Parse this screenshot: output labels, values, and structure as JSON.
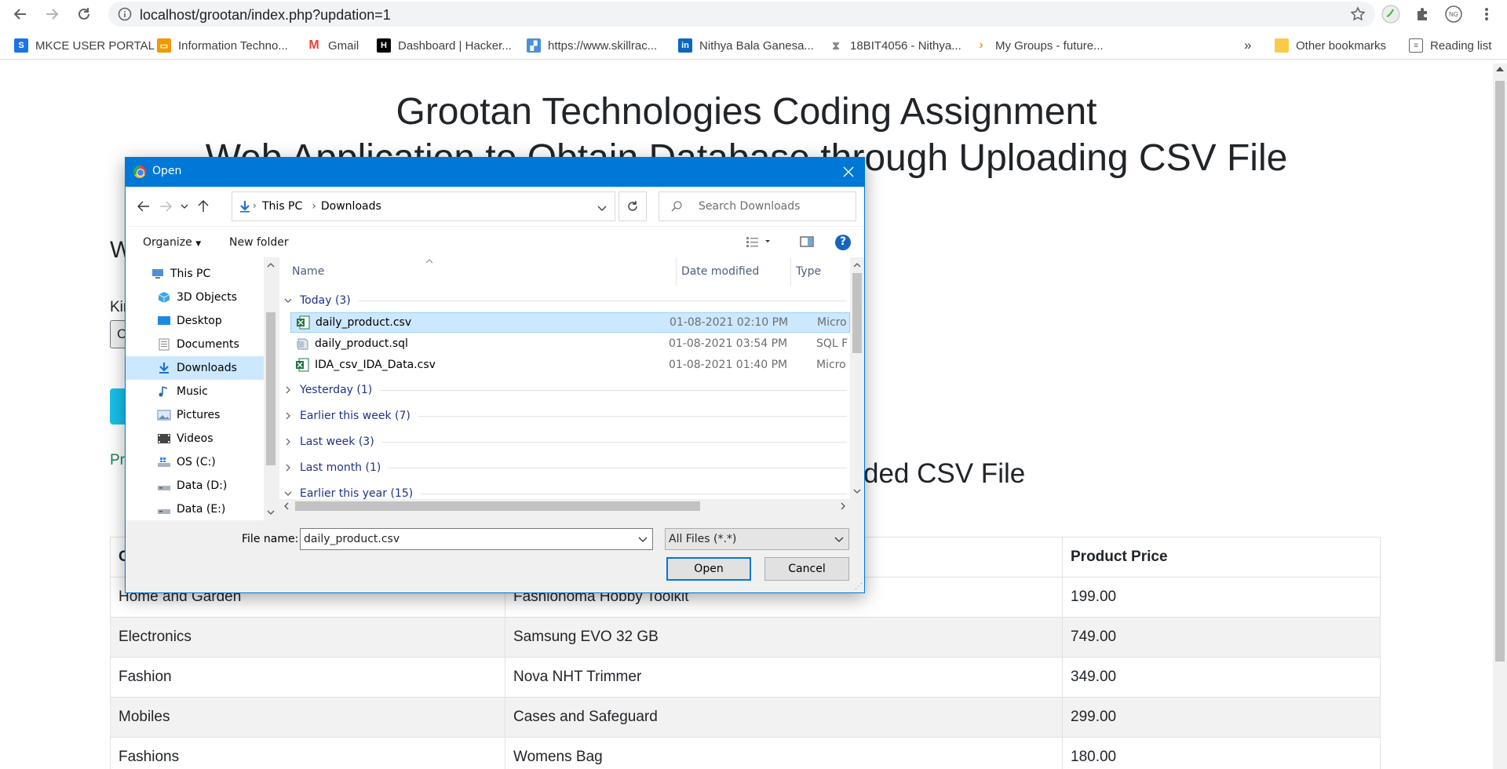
{
  "browser": {
    "url": "localhost/grootan/index.php?updation=1",
    "profile_initials": "NG",
    "bookmarks": [
      {
        "label": "MKCE USER PORTAL",
        "icon": "portal-icon",
        "color": "#1a73e8"
      },
      {
        "label": "Information Techno...",
        "icon": "monitor-icon",
        "color": "#f29900"
      },
      {
        "label": "Gmail",
        "icon": "gmail-icon",
        "color": "#ea4335"
      },
      {
        "label": "Dashboard | Hacker...",
        "icon": "hackerrank-icon",
        "color": "#000000"
      },
      {
        "label": "https://www.skillrac...",
        "icon": "skillrack-icon",
        "color": "#4a90d9"
      },
      {
        "label": "Nithya Bala Ganesa...",
        "icon": "linkedin-icon",
        "color": "#0a66c2"
      },
      {
        "label": "18BIT4056 - Nithya...",
        "icon": "hourglass-icon",
        "color": "#888888"
      },
      {
        "label": "My Groups - future...",
        "icon": "chevron-icon",
        "color": "#f4a100"
      }
    ],
    "more_label": "»",
    "other_bookmarks": "Other bookmarks",
    "reading_list": "Reading list"
  },
  "page": {
    "title_line1": "Grootan Technologies Coding Assignment",
    "title_line2": "Web Application to Obtain Database through Uploading CSV File",
    "heading_partial": "W",
    "label_partial": "Kin",
    "input_partial": "C",
    "status_partial": "Pr",
    "section_title": "ded CSV File",
    "table": {
      "headers": [
        "C",
        "",
        "Product Price"
      ],
      "rows": [
        [
          "Home and Garden",
          "Fashionoma Hobby Toolkit",
          "199.00"
        ],
        [
          "Electronics",
          "Samsung EVO 32 GB",
          "749.00"
        ],
        [
          "Fashion",
          "Nova NHT Trimmer",
          "349.00"
        ],
        [
          "Mobiles",
          "Cases and Safeguard",
          "299.00"
        ],
        [
          "Fashions",
          "Womens Bag",
          "180.00"
        ]
      ]
    }
  },
  "dialog": {
    "title": "Open",
    "breadcrumb": [
      "This PC",
      "Downloads"
    ],
    "search_placeholder": "Search Downloads",
    "organize": "Organize",
    "new_folder": "New folder",
    "help": "?",
    "nav_items": [
      {
        "label": "This PC",
        "icon": "pc-icon",
        "selected": false,
        "indent": 0
      },
      {
        "label": "3D Objects",
        "icon": "cube-icon",
        "selected": false,
        "indent": 1
      },
      {
        "label": "Desktop",
        "icon": "desktop-icon",
        "selected": false,
        "indent": 1
      },
      {
        "label": "Documents",
        "icon": "documents-icon",
        "selected": false,
        "indent": 1
      },
      {
        "label": "Downloads",
        "icon": "downloads-icon",
        "selected": true,
        "indent": 1
      },
      {
        "label": "Music",
        "icon": "music-icon",
        "selected": false,
        "indent": 1
      },
      {
        "label": "Pictures",
        "icon": "pictures-icon",
        "selected": false,
        "indent": 1
      },
      {
        "label": "Videos",
        "icon": "videos-icon",
        "selected": false,
        "indent": 1
      },
      {
        "label": "OS (C:)",
        "icon": "drive-icon",
        "selected": false,
        "indent": 1
      },
      {
        "label": "Data (D:)",
        "icon": "drive-icon",
        "selected": false,
        "indent": 1
      },
      {
        "label": "Data (E:)",
        "icon": "drive-icon",
        "selected": false,
        "indent": 1
      }
    ],
    "columns": {
      "name": "Name",
      "date": "Date modified",
      "type": "Type"
    },
    "groups": [
      {
        "label": "Today (3)",
        "expanded": true,
        "files": [
          {
            "name": "daily_product.csv",
            "date": "01-08-2021 02:10 PM",
            "type": "Micro",
            "icon": "excel-icon",
            "selected": true
          },
          {
            "name": "daily_product.sql",
            "date": "01-08-2021 03:54 PM",
            "type": "SQL F",
            "icon": "sql-file-icon",
            "selected": false
          },
          {
            "name": "IDA_csv_IDA_Data.csv",
            "date": "01-08-2021 01:40 PM",
            "type": "Micro",
            "icon": "excel-icon",
            "selected": false
          }
        ]
      },
      {
        "label": "Yesterday (1)",
        "expanded": false,
        "files": []
      },
      {
        "label": "Earlier this week (7)",
        "expanded": false,
        "files": []
      },
      {
        "label": "Last week (3)",
        "expanded": false,
        "files": []
      },
      {
        "label": "Last month (1)",
        "expanded": false,
        "files": []
      },
      {
        "label": "Earlier this year (15)",
        "expanded": true,
        "files": []
      }
    ],
    "file_name_label": "File name:",
    "file_name_value": "daily_product.csv",
    "filter_value": "All Files (*.*)",
    "open_button": "Open",
    "cancel_button": "Cancel"
  }
}
